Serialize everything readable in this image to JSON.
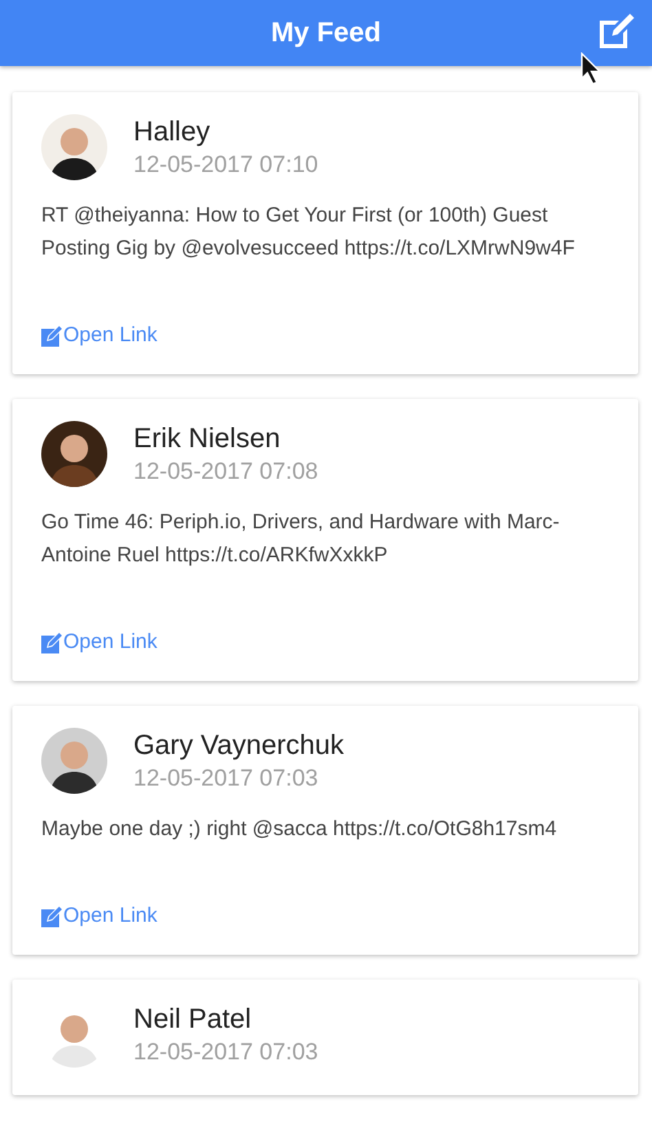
{
  "header": {
    "title": "My Feed"
  },
  "posts": [
    {
      "author": "Halley",
      "time": "12-05-2017 07:10",
      "text": "RT @theiyanna: How to Get Your First (or 100th) Guest Posting Gig by @evolvesucceed https://t.co/LXMrwN9w4F",
      "link": "Open Link"
    },
    {
      "author": "Erik Nielsen",
      "time": "12-05-2017 07:08",
      "text": "Go Time 46: Periph.io, Drivers, and Hardware with Marc-Antoine Ruel https://t.co/ARKfwXxkkP",
      "link": "Open Link"
    },
    {
      "author": "Gary Vaynerchuk",
      "time": "12-05-2017 07:03",
      "text": "Maybe one day ;) right @sacca https://t.co/OtG8h17sm4",
      "link": "Open Link"
    },
    {
      "author": "Neil Patel",
      "time": "12-05-2017 07:03"
    }
  ]
}
